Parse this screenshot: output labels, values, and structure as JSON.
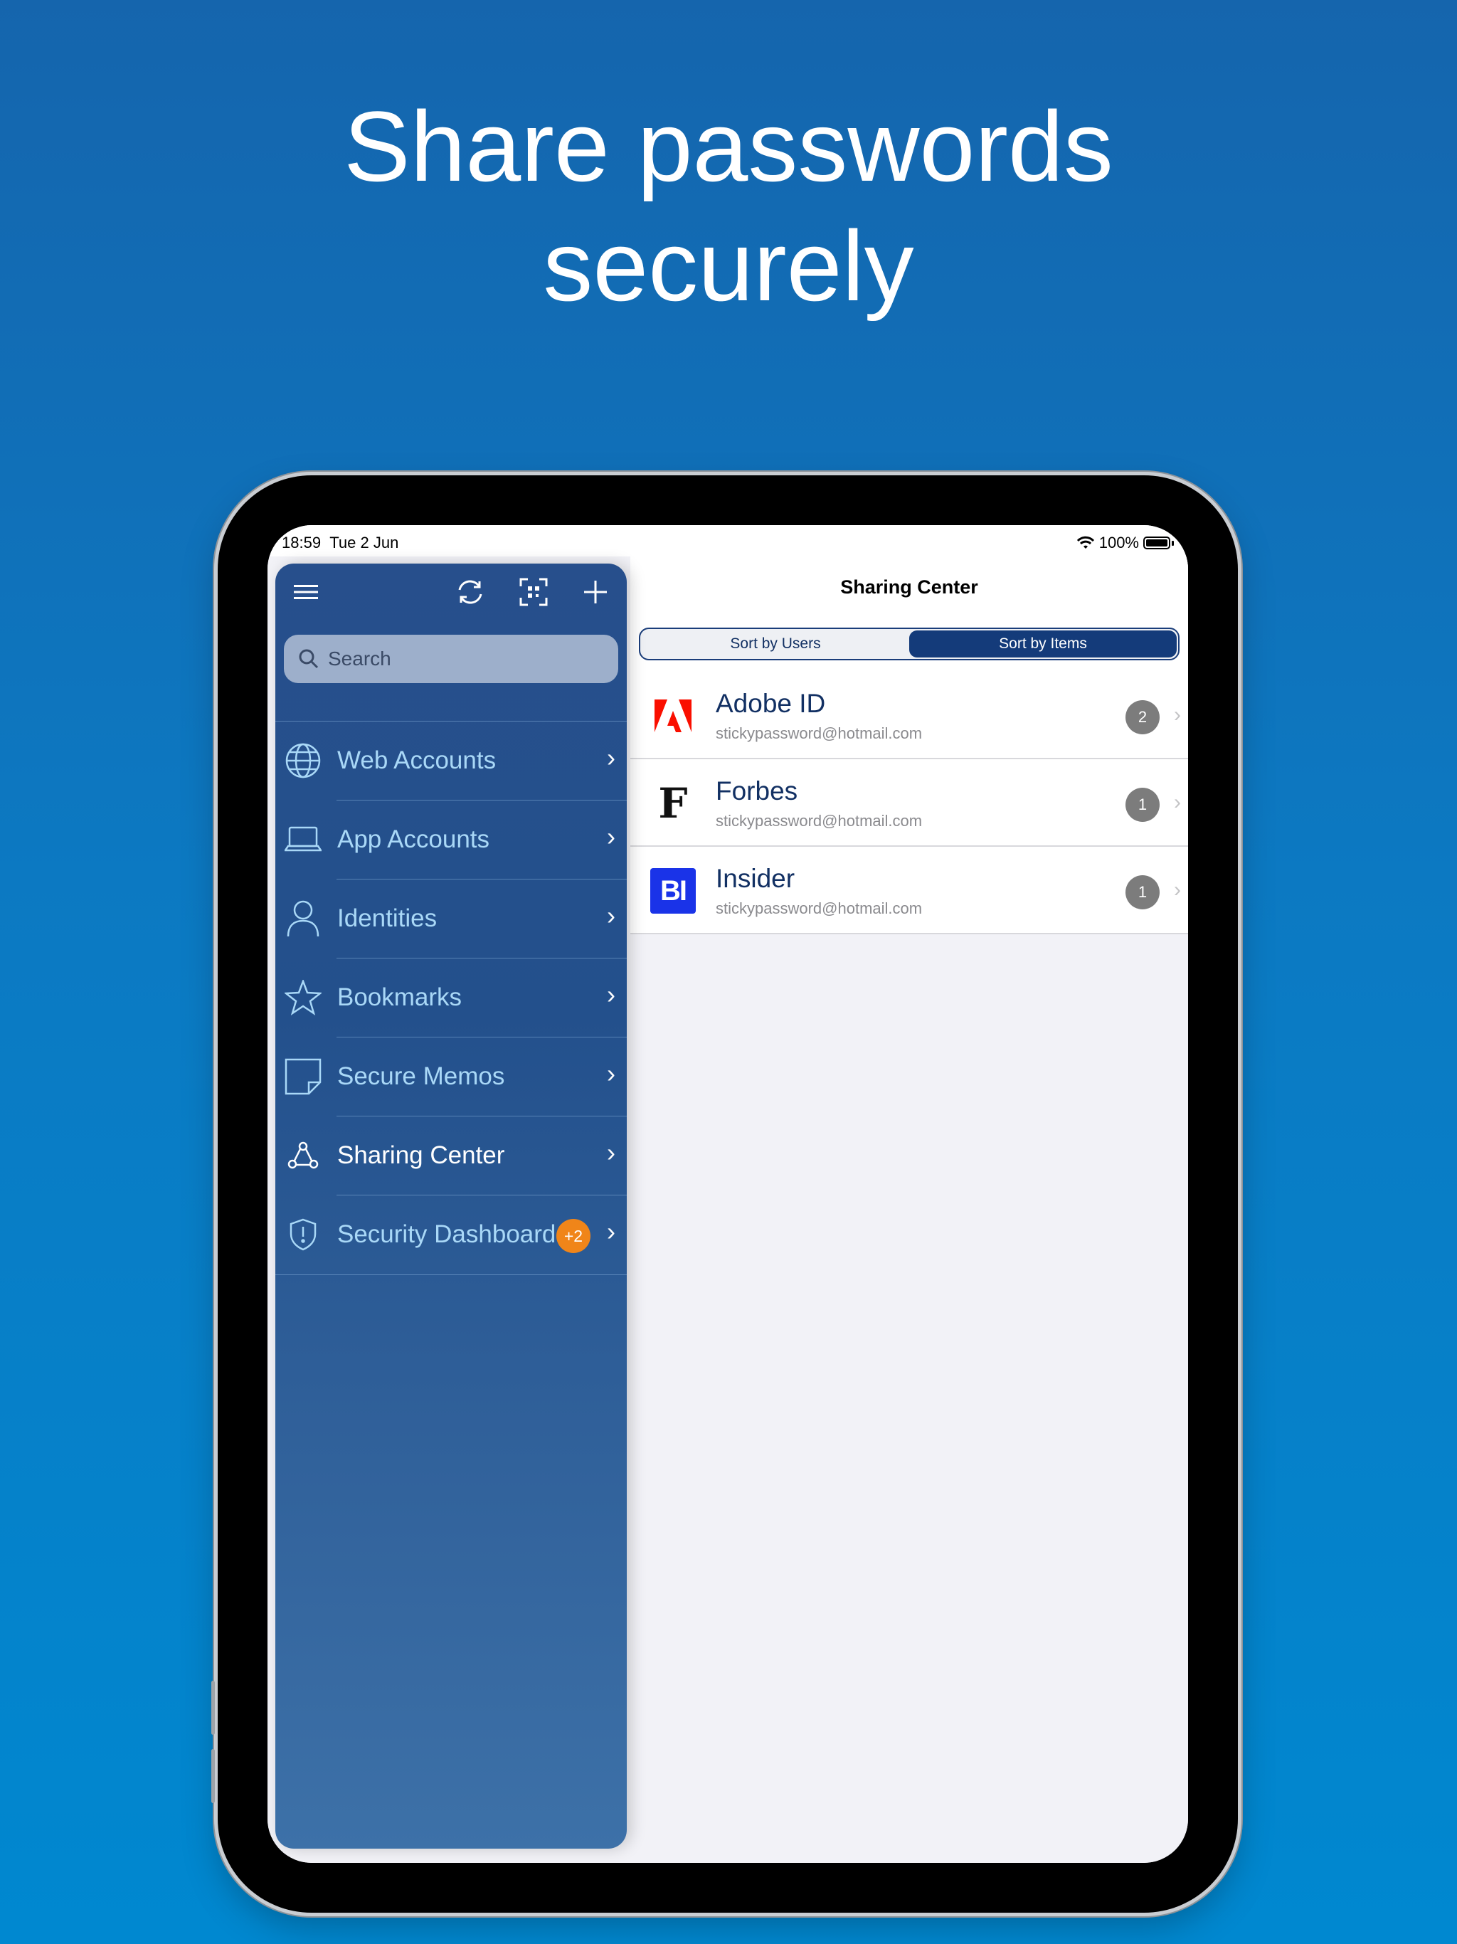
{
  "headline": {
    "line1": "Share passwords",
    "line2": "securely"
  },
  "status_bar": {
    "time": "18:59",
    "date": "Tue 2 Jun",
    "battery": "100%"
  },
  "sidebar": {
    "search_placeholder": "Search",
    "items": [
      {
        "label": "Web Accounts",
        "icon": "globe-icon"
      },
      {
        "label": "App Accounts",
        "icon": "laptop-icon"
      },
      {
        "label": "Identities",
        "icon": "person-icon"
      },
      {
        "label": "Bookmarks",
        "icon": "star-icon"
      },
      {
        "label": "Secure Memos",
        "icon": "memo-icon"
      },
      {
        "label": "Sharing Center",
        "icon": "sharing-icon",
        "active": true
      },
      {
        "label": "Security Dashboard",
        "icon": "shield-icon",
        "badge": "+2"
      }
    ]
  },
  "detail": {
    "title": "Sharing Center",
    "segments": {
      "users": "Sort by Users",
      "items": "Sort by Items",
      "selected": "items"
    },
    "rows": [
      {
        "name": "Adobe ID",
        "email": "stickypassword@hotmail.com",
        "count": "2",
        "logo": "adobe-logo"
      },
      {
        "name": "Forbes",
        "email": "stickypassword@hotmail.com",
        "count": "1",
        "logo": "forbes-logo",
        "logo_text": "F"
      },
      {
        "name": "Insider",
        "email": "stickypassword@hotmail.com",
        "count": "1",
        "logo": "insider-logo",
        "logo_text": "BI"
      }
    ]
  },
  "colors": {
    "accent": "#143b7a",
    "badge": "#f08519",
    "adobe_red": "#fa0f00",
    "insider_blue": "#1a33e8"
  }
}
